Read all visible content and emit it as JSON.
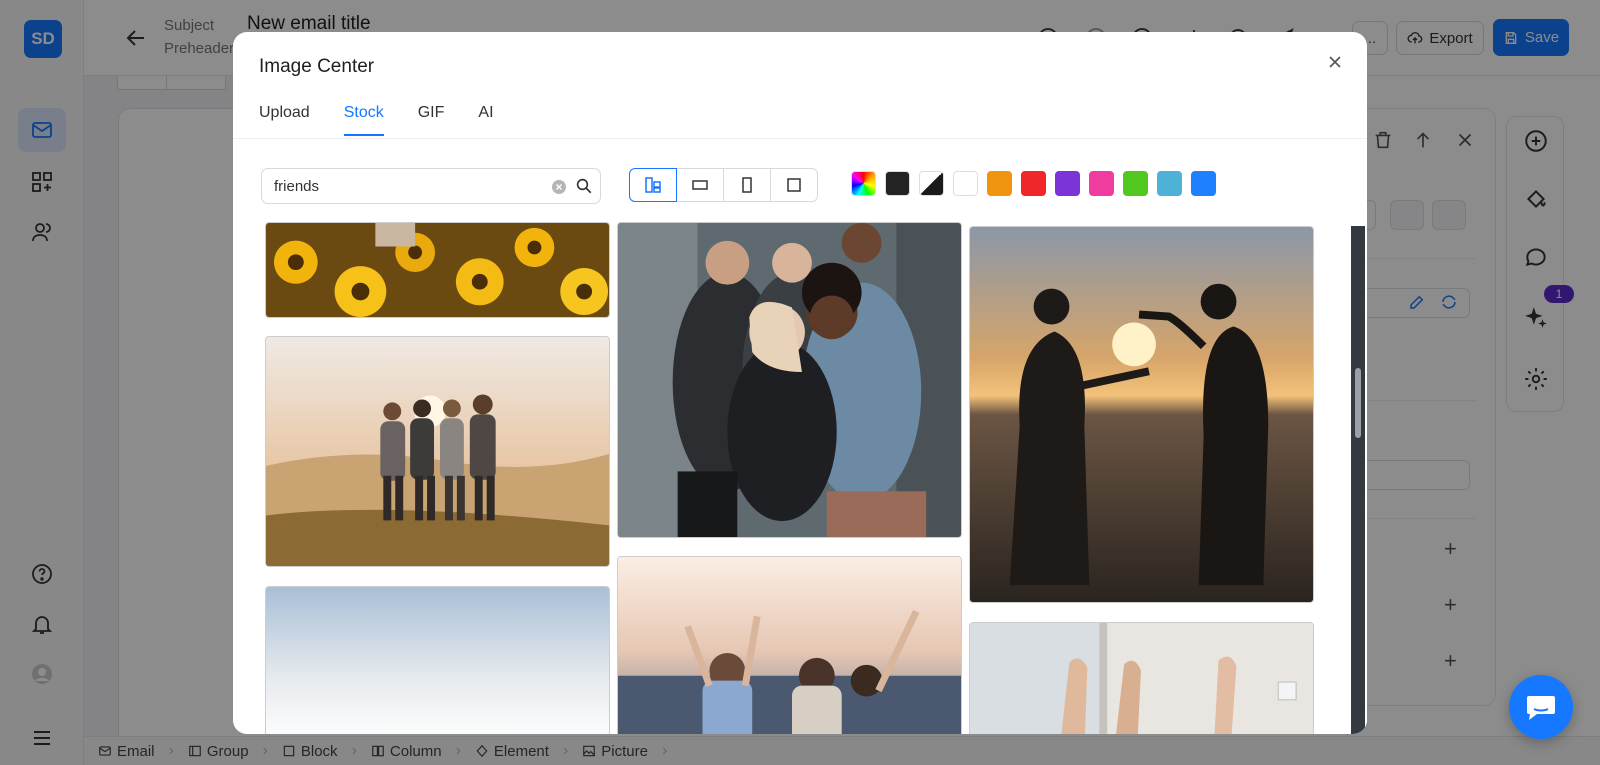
{
  "app": {
    "logo_text": "SD",
    "subject_label": "Subject",
    "preheader_label": "Preheader",
    "email_title": "New email title",
    "more_label": "...",
    "export_label": "Export",
    "save_label": "Save",
    "notification_badge": "1",
    "accent_color": "#1677ff"
  },
  "modal": {
    "title": "Image Center",
    "tabs": [
      {
        "label": "Upload",
        "active": false
      },
      {
        "label": "Stock",
        "active": true
      },
      {
        "label": "GIF",
        "active": false
      },
      {
        "label": "AI",
        "active": false
      }
    ],
    "search": {
      "value": "friends"
    },
    "layout_options": [
      "all-layout-icon",
      "landscape-icon",
      "portrait-icon",
      "square-icon"
    ],
    "color_filters": [
      "rainbow",
      "#232323",
      "black-white",
      "#ffffff",
      "#f0930e",
      "#f0262a",
      "#7a34d8",
      "#ef3c9f",
      "#52c81f",
      "#4db2d6",
      "#1e80ff"
    ],
    "images": [
      "sunflower-field-photo",
      "friends-hugging-at-sunset-photo",
      "beach-sky-photo",
      "group-of-friends-sitting-photo",
      "friends-raising-arms-photo",
      "beach-silhouettes-photo",
      "feet-on-window-sill-photo"
    ]
  },
  "breadcrumb": [
    "Email",
    "Group",
    "Block",
    "Column",
    "Element",
    "Picture"
  ]
}
